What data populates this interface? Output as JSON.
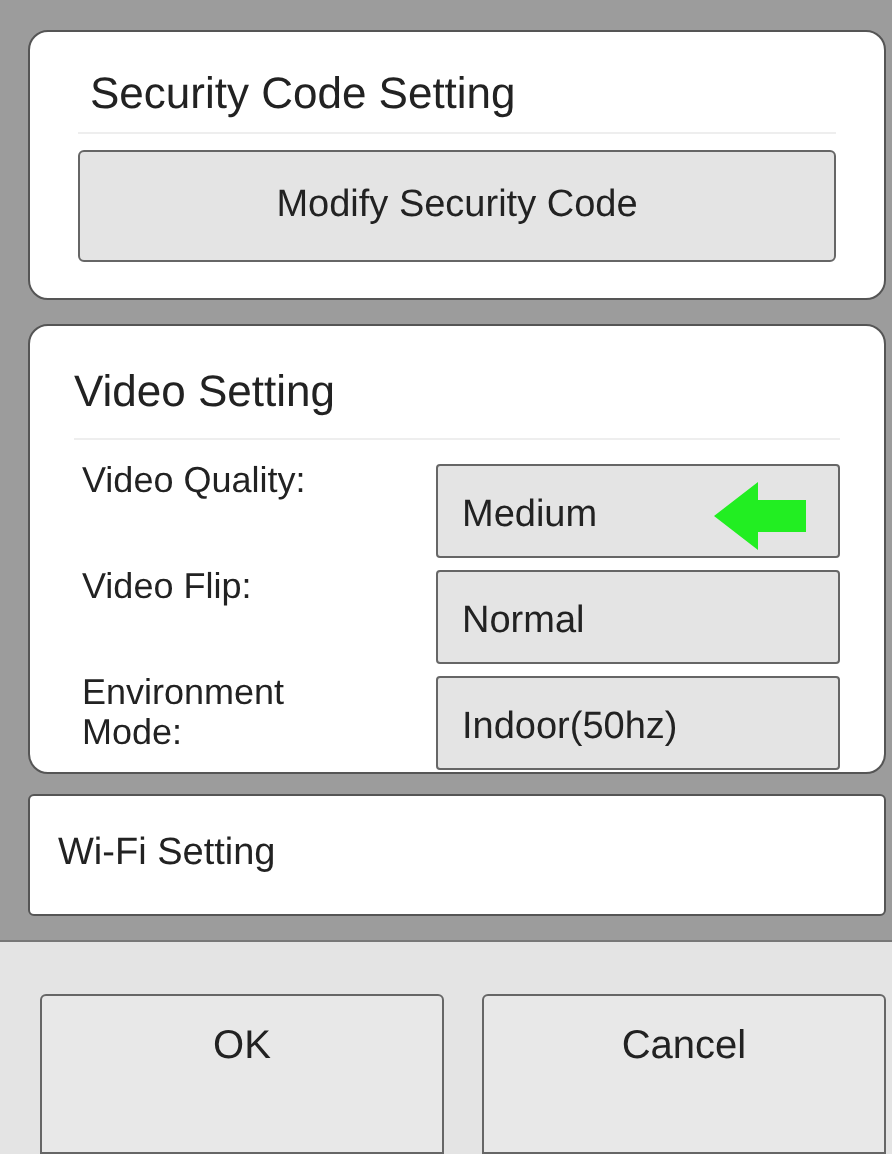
{
  "security": {
    "title": "Security Code Setting",
    "button": "Modify Security Code"
  },
  "video": {
    "title": "Video Setting",
    "rows": [
      {
        "label": "Video Quality:",
        "value": "Medium",
        "pointer": true
      },
      {
        "label": "Video Flip:",
        "value": "Normal",
        "pointer": false
      },
      {
        "label": "Environment Mode:",
        "value": "Indoor(50hz)",
        "pointer": false
      }
    ]
  },
  "wifi": {
    "title": "Wi-Fi Setting"
  },
  "buttons": [
    "OK",
    "Cancel"
  ]
}
